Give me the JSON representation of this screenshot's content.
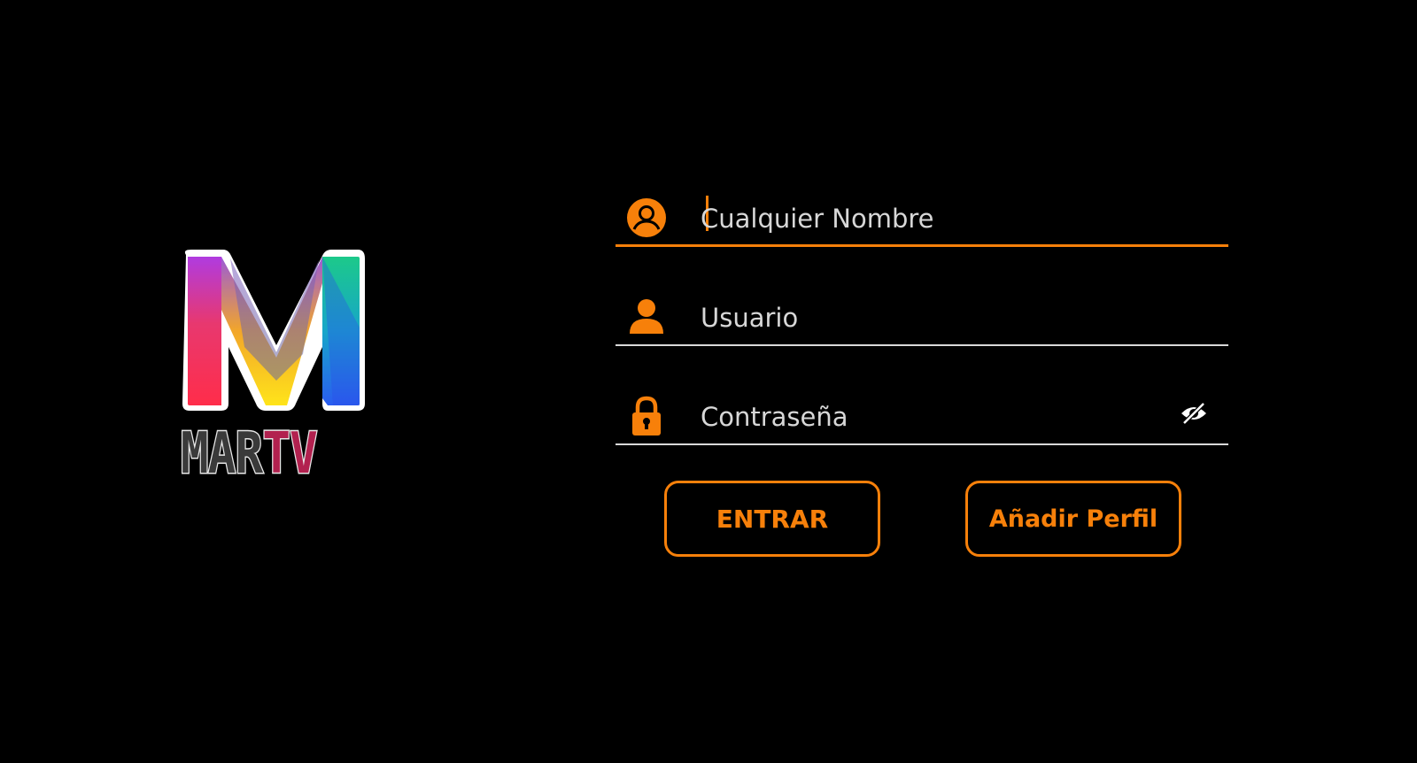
{
  "app": {
    "logo_text_left": "MAR",
    "logo_text_right": "TV"
  },
  "form": {
    "name_field": {
      "placeholder": "Cualquier Nombre",
      "value": ""
    },
    "user_field": {
      "placeholder": "Usuario",
      "value": ""
    },
    "password_field": {
      "placeholder": "Contraseña",
      "value": ""
    },
    "enter_button": "ENTRAR",
    "add_profile_button": "Añadir Perfil"
  },
  "icons": {
    "name_field": "profile-circle-icon",
    "user_field": "person-icon",
    "password_field": "lock-icon",
    "visibility_toggle": "eye-slash-icon"
  },
  "colors": {
    "accent": "#f7800a",
    "background": "#000000",
    "text": "#d7d7d7",
    "underline": "#d9d9d9",
    "logo_tv": "#b2214f"
  }
}
